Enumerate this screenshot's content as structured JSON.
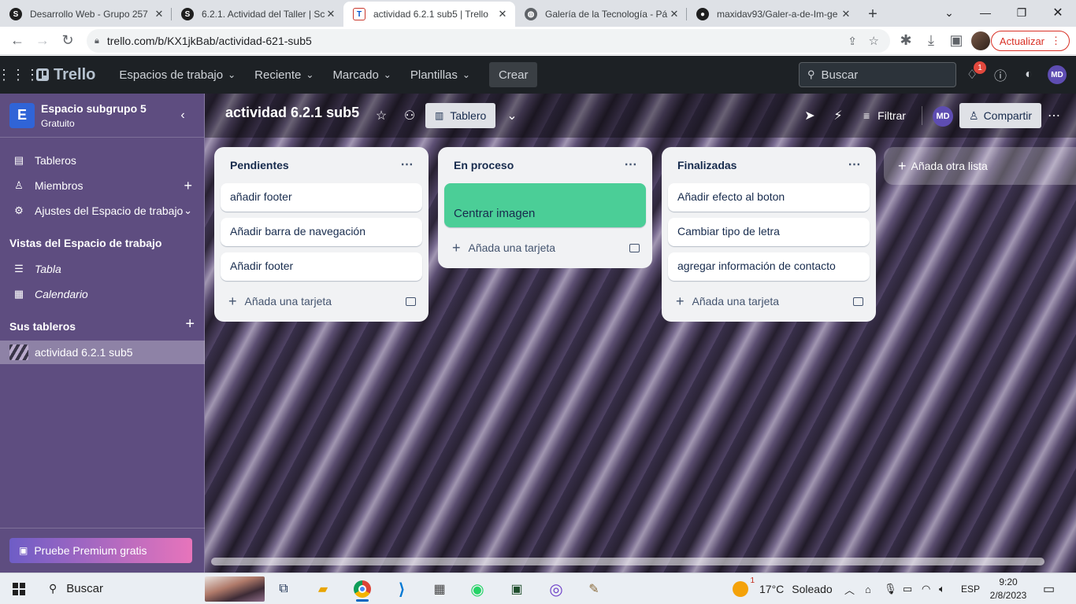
{
  "browser": {
    "tabs": [
      {
        "title": "Desarrollo Web - Grupo 257",
        "favicon": "S"
      },
      {
        "title": "6.2.1. Actividad del Taller | Sc",
        "favicon": "S"
      },
      {
        "title": "actividad 6.2.1 sub5 | Trello",
        "favicon": "T",
        "active": true
      },
      {
        "title": "Galería de la Tecnología - Pá",
        "favicon": "globe"
      },
      {
        "title": "maxidav93/Galer-a-de-Im-ge",
        "favicon": "github"
      }
    ],
    "url": "trello.com/b/KX1jkBab/actividad-621-sub5",
    "update_label": "Actualizar"
  },
  "appbar": {
    "logo": "Trello",
    "menus": [
      "Espacios de trabajo",
      "Reciente",
      "Marcado",
      "Plantillas"
    ],
    "create_label": "Crear",
    "search_placeholder": "Buscar",
    "notification_count": "1",
    "user_initials": "MD"
  },
  "sidebar": {
    "workspace_initial": "E",
    "workspace_name": "Espacio subgrupo 5",
    "workspace_plan": "Gratuito",
    "items": [
      {
        "label": "Tableros",
        "icon": "board-icon"
      },
      {
        "label": "Miembros",
        "icon": "person-icon"
      },
      {
        "label": "Ajustes del Espacio de trabajo",
        "icon": "gear-icon"
      }
    ],
    "views_heading": "Vistas del Espacio de trabajo",
    "views": [
      {
        "label": "Tabla",
        "icon": "table-icon"
      },
      {
        "label": "Calendario",
        "icon": "calendar-icon"
      }
    ],
    "boards_heading": "Sus tableros",
    "boards": [
      "actividad 6.2.1 sub5"
    ],
    "premium_label": "Pruebe Premium gratis"
  },
  "board": {
    "title": "actividad 6.2.1 sub5",
    "view_label": "Tablero",
    "filter_label": "Filtrar",
    "member_initials": "MD",
    "share_label": "Compartir",
    "add_list_label": "Añada otra lista",
    "add_card_label": "Añada una tarjeta",
    "lists": [
      {
        "title": "Pendientes",
        "cards": [
          "añadir footer",
          "Añadir barra de navegación",
          "Añadir footer"
        ]
      },
      {
        "title": "En proceso",
        "cards": [
          "Centrar imagen"
        ]
      },
      {
        "title": "Finalizadas",
        "cards": [
          "Añadir efecto al boton",
          "Cambiar tipo de letra",
          "agregar información de contacto"
        ]
      }
    ],
    "label_color": "#4bce97"
  },
  "taskbar": {
    "search_label": "Buscar",
    "weather_badge": "1",
    "temperature": "17°C",
    "weather_text": "Soleado",
    "language": "ESP",
    "time": "9:20",
    "date": "2/8/2023"
  }
}
